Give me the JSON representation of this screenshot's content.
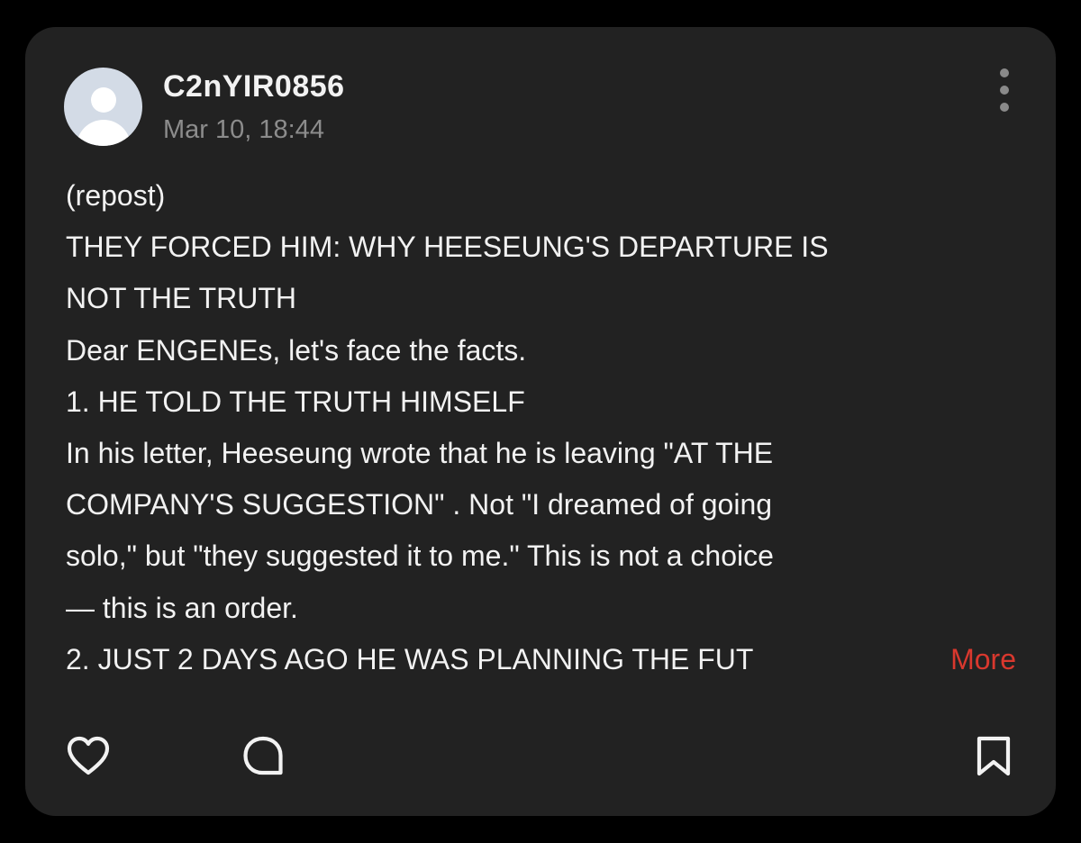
{
  "post": {
    "username": "C2nYIR0856",
    "timestamp": "Mar 10, 18:44",
    "lines": [
      "(repost)",
      "THEY FORCED HIM: WHY HEESEUNG'S DEPARTURE IS",
      "NOT THE TRUTH",
      "Dear ENGENEs, let's face the facts.",
      "1. HE TOLD THE TRUTH HIMSELF",
      "In his letter, Heeseung wrote that he is leaving \"AT THE",
      "COMPANY'S SUGGESTION\" . Not \"I dreamed of going",
      "solo,\" but \"they suggested it to me.\" This is not a choice",
      "— this is an order."
    ],
    "last_line": "2. JUST 2 DAYS AGO HE WAS PLANNING THE FUT",
    "more_label": "More"
  },
  "icons": {
    "avatar": "default-avatar-icon",
    "menu": "more-vertical-icon",
    "like": "heart-icon",
    "comment": "comment-bubble-icon",
    "save": "bookmark-icon"
  },
  "colors": {
    "background": "#000000",
    "card": "#222222",
    "text": "#f2f2f2",
    "muted": "#8c8c8c",
    "accent": "#d9382e"
  }
}
